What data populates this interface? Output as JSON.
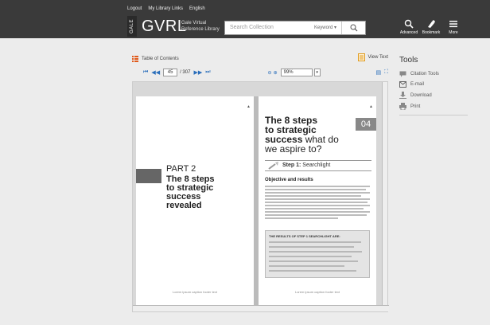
{
  "header": {
    "links": [
      "Logout",
      "My Library Links",
      "English"
    ],
    "brand_vertical": "GALE",
    "brand": "GVRL",
    "brand_sub": [
      "Gale Virtual",
      "Reference Library"
    ],
    "search_placeholder": "Search Collection",
    "search_scope": "Keyword",
    "tools": [
      {
        "label": "Advanced",
        "icon": "advanced-search-icon"
      },
      {
        "label": "Bookmark",
        "icon": "bookmark-icon"
      },
      {
        "label": "More",
        "icon": "menu-icon"
      }
    ]
  },
  "viewer": {
    "toc_label": "Table of Contents",
    "view_text_label": "View Text",
    "page_current": "45",
    "page_total": "/ 307",
    "zoom": "99%"
  },
  "left_page": {
    "part": "PART 2",
    "title_lines": [
      "The 8 steps",
      "to strategic",
      "success",
      "revealed"
    ],
    "footer": "Lorem ipsum caption footer text"
  },
  "right_page": {
    "heading_lines": [
      "The 8 steps",
      "to strategic"
    ],
    "heading_bold_word": "success",
    "heading_light": " what do",
    "heading_last": "we aspire to?",
    "chapter_num": "04",
    "step_label": "Step 1:",
    "step_name": " Searchlight",
    "section": "Objective and results",
    "box_title": "THE RESULTS OF STEP 1 SEARCHLIGHT ARE:",
    "footer": "Lorem ipsum caption footer text"
  },
  "tools": {
    "title": "Tools",
    "items": [
      {
        "label": "Citation Tools",
        "icon": "citation-icon"
      },
      {
        "label": "E-mail",
        "icon": "email-icon"
      },
      {
        "label": "Download",
        "icon": "download-icon"
      },
      {
        "label": "Print",
        "icon": "print-icon"
      }
    ]
  },
  "colors": {
    "topbar": "#3a3a3a",
    "accent": "#2a6ebb",
    "toc_icon": "#e05a1c"
  }
}
